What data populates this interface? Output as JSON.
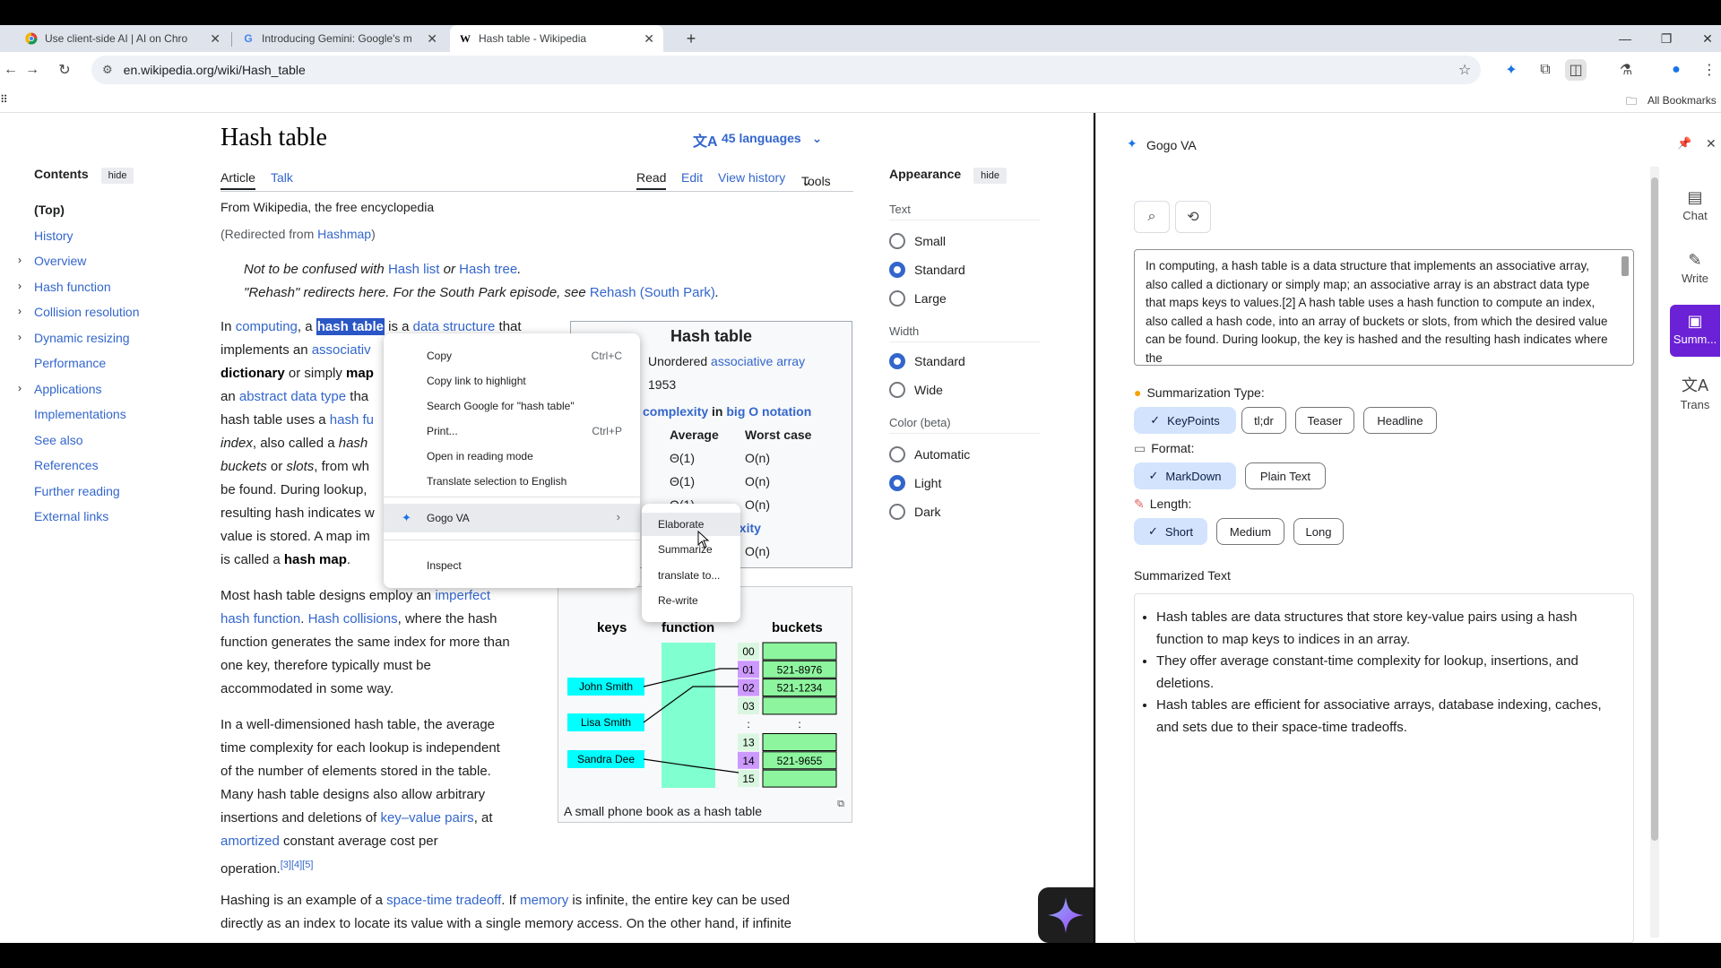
{
  "tabs": [
    {
      "title": "Use client-side AI | AI on Chro",
      "icon": "chrome-icon"
    },
    {
      "title": "Introducing Gemini: Google's m",
      "icon": "google-icon"
    },
    {
      "title": "Hash table - Wikipedia",
      "icon": "wikipedia-icon"
    }
  ],
  "address": "en.wikipedia.org/wiki/Hash_table",
  "bookmarks_label": "All Bookmarks",
  "toc": {
    "title": "Contents",
    "hide": "hide",
    "items": [
      "(Top)",
      "History",
      "Overview",
      "Hash function",
      "Collision resolution",
      "Dynamic resizing",
      "Performance",
      "Applications",
      "Implementations",
      "See also",
      "References",
      "Further reading",
      "External links"
    ]
  },
  "article": {
    "title": "Hash table",
    "languages": "45 languages",
    "tab_article": "Article",
    "tab_talk": "Talk",
    "tab_read": "Read",
    "tab_edit": "Edit",
    "tab_history": "View history",
    "tab_tools": "Tools",
    "from": "From Wikipedia, the free encyclopedia",
    "redirect": "(Redirected from Hashmap)",
    "hatnote1_a": "Not to be confused with ",
    "hatnote1_l1": "Hash list",
    "hatnote1_b": " or ",
    "hatnote1_l2": "Hash tree",
    "hatnote1_c": ".",
    "hatnote2_a": "\"Rehash\" redirects here. For the South Park episode, see ",
    "hatnote2_l": "Rehash (South Park)",
    "hatnote2_c": ".",
    "p1_l1_in": "In ",
    "p1_l1_computing": "computing",
    "p1_l1_a": ", a ",
    "p1_l1_sel": "hash table",
    "p1_l1_is": " is a ",
    "p1_l1_ds": "data structure",
    "p1_l1_that": " that",
    "p1_l2": "implements an ",
    "p1_l2_link": "associativ",
    "p1_l3_dict": "dictionary",
    "p1_l3_or": " or simply ",
    "p1_l3_map": "map",
    "p1_l4_an": "an ",
    "p1_l4_adt": "abstract data type",
    "p1_l4_tha": " tha",
    "p1_l5": "hash table uses a ",
    "p1_l5_l": "hash fu",
    "p1_l6_index": "index",
    "p1_l6_rest": ", also called a ",
    "p1_l6_hash": "hash",
    "p1_l7_b": "buckets",
    "p1_l7_or": " or ",
    "p1_l7_s": "slots",
    "p1_l7_rest": ", from wh",
    "p1_l8": "be found. During lookup,",
    "p1_l9": "resulting hash indicates w",
    "p1_l10": "value is stored. A map im",
    "p1_l11_a": "is called a ",
    "p1_l11_b": "hash map",
    "p1_l11_c": ".",
    "p2_l1_a": "Most hash table designs employ an ",
    "p2_l1_b": "imperfect",
    "p2_l2_a": "hash function",
    "p2_l2_b": ". ",
    "p2_l2_c": "Hash collisions",
    "p2_l2_d": ", where the hash",
    "p2_l3": "function generates the same index for more than",
    "p2_l4": "one key, therefore typically must be",
    "p2_l5": "accommodated in some way.",
    "p3_l1": "In a well-dimensioned hash table, the average",
    "p3_l2": "time complexity for each lookup is independent",
    "p3_l3": "of the number of elements stored in the table.",
    "p3_l4": "Many hash table designs also allow arbitrary",
    "p3_l5_a": "insertions and deletions of ",
    "p3_l5_b": "key–value pairs",
    "p3_l5_c": ", at",
    "p3_l6_a": "amortized",
    "p3_l6_b": " constant average cost per",
    "p3_l7_a": "operation.",
    "p3_l7_sup": "[3][4][5]",
    "p4_l1_a": "Hashing is an example of a ",
    "p4_l1_b": "space-time tradeoff",
    "p4_l1_c": ". If ",
    "p4_l1_d": "memory",
    "p4_l1_e": " is infinite, the entire key can be used",
    "p4_l2": "directly as an index to locate its value with a single memory access. On the other hand, if infinite"
  },
  "infobox": {
    "title": "Hash table",
    "type_a": "Unordered ",
    "type_b": "associative array",
    "year": "1953",
    "complexity": "complexity",
    "in": " in ",
    "bigo": "big O notation",
    "col_avg": "Average",
    "col_worst": "Worst case",
    "rows": [
      {
        "avg": "Θ(1)",
        "worst": "O(n)"
      },
      {
        "avg": "Θ(1)",
        "worst": "O(n)"
      },
      {
        "avg": "Θ(1)",
        "worst": "O(n)"
      }
    ],
    "space": "exity",
    "space_worst": "O(n)"
  },
  "figure": {
    "head_keys": "keys",
    "head_function": "function",
    "head_buckets": "buckets",
    "keys": [
      "John Smith",
      "Lisa Smith",
      "Sandra Dee"
    ],
    "indices": [
      "00",
      "01",
      "02",
      "03",
      ":",
      "13",
      "14",
      "15"
    ],
    "values": [
      "",
      "521-8976",
      "521-1234",
      "",
      ":",
      "",
      "521-9655",
      ""
    ],
    "caption": "A small phone book as a hash table"
  },
  "appearance": {
    "title": "Appearance",
    "hide": "hide",
    "text": "Text",
    "text_opts": [
      "Small",
      "Standard",
      "Large"
    ],
    "width": "Width",
    "width_opts": [
      "Standard",
      "Wide"
    ],
    "color": "Color (beta)",
    "color_opts": [
      "Automatic",
      "Light",
      "Dark"
    ]
  },
  "context_menu": {
    "items": [
      {
        "label": "Copy",
        "key": "Ctrl+C"
      },
      {
        "label": "Copy link to highlight",
        "key": ""
      },
      {
        "label": "Search Google for \"hash table\"",
        "key": ""
      },
      {
        "label": "Print...",
        "key": "Ctrl+P"
      },
      {
        "label": "Open in reading mode",
        "key": ""
      },
      {
        "label": "Translate selection to English",
        "key": ""
      }
    ],
    "gogo": "Gogo VA",
    "inspect": "Inspect",
    "submenu": [
      "Elaborate",
      "Summarize",
      "translate to...",
      "Re-write"
    ]
  },
  "panel": {
    "title": "Gogo VA",
    "input_text": "In computing, a hash table is a data structure that implements an associative array, also called a dictionary or simply map; an associative array is an abstract data type that maps keys to values.[2] A hash table uses a hash function to compute an index, also called a hash code, into an array of buckets or slots, from which the desired value can be found. During lookup, the key is hashed and the resulting hash indicates where the",
    "summ_type_label": "Summarization Type:",
    "summ_types": [
      "KeyPoints",
      "tl;dr",
      "Teaser",
      "Headline"
    ],
    "format_label": "Format:",
    "formats": [
      "MarkDown",
      "Plain Text"
    ],
    "length_label": "Length:",
    "lengths": [
      "Short",
      "Medium",
      "Long"
    ],
    "summarized_label": "Summarized Text",
    "bullets": [
      "Hash tables are data structures that store key-value pairs using a hash function to map keys to indices in an array.",
      "They offer average constant-time complexity for lookup, insertions, and deletions.",
      "Hash tables are efficient for associative arrays, database indexing, caches, and sets due to their space-time tradeoffs."
    ],
    "rail": [
      "Chat",
      "Write",
      "Summ...",
      "Trans"
    ]
  },
  "colors": {
    "accent": "#3366cc",
    "selection": "#2a56c6",
    "panel_selected": "#d3e3fd",
    "rail_active": "#6b21d6",
    "bucket_green": "#8ef59f",
    "index_purple": "#cc99ff",
    "key_cyan": "#00ffff",
    "function_teal": "#80ffd0"
  }
}
